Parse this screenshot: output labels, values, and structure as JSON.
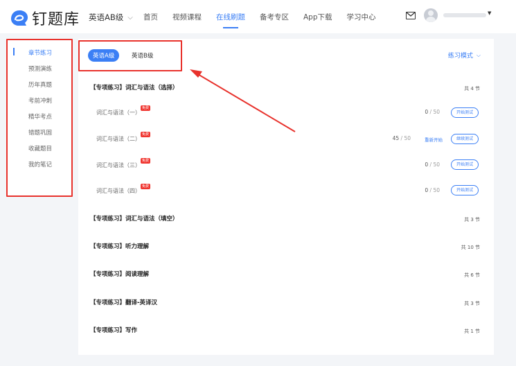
{
  "header": {
    "app_title": "钉题库",
    "level_select": "英语AB级",
    "nav": [
      "首页",
      "视频课程",
      "在线刷题",
      "备考专区",
      "App下载",
      "学习中心"
    ],
    "nav_active_index": 2,
    "icons": [
      "logo-icon",
      "chevron-down-icon",
      "mail-icon",
      "avatar-icon",
      "chevron-down-icon"
    ]
  },
  "sidebar": {
    "items": [
      "章节练习",
      "预测演练",
      "历年真题",
      "考前冲刺",
      "精华考点",
      "错题巩固",
      "收藏题目",
      "我的笔记"
    ],
    "active_index": 0
  },
  "main": {
    "tabs": [
      "英语A级",
      "英语B级"
    ],
    "active_tab": 0,
    "mode_label": "练习模式",
    "sections": [
      {
        "title": "【专项练习】词汇与语法（选择）",
        "count": "共 4 节",
        "rows": [
          {
            "label": "词汇与语法（一）",
            "badge": "免费",
            "done": "0",
            "total": " / 50",
            "reset": "",
            "button": "开始测试"
          },
          {
            "label": "词汇与语法（二）",
            "badge": "免费",
            "done": "45",
            "total": " / 50",
            "reset": "重新开始",
            "button": "继续测试"
          },
          {
            "label": "词汇与语法（三）",
            "badge": "免费",
            "done": "0",
            "total": " / 50",
            "reset": "",
            "button": "开始测试"
          },
          {
            "label": "词汇与语法（四）",
            "badge": "免费",
            "done": "0",
            "total": " / 50",
            "reset": "",
            "button": "开始测试"
          }
        ]
      },
      {
        "title": "【专项练习】词汇与语法（填空）",
        "count": "共 3 节"
      },
      {
        "title": "【专项练习】听力理解",
        "count": "共 10 节"
      },
      {
        "title": "【专项练习】阅读理解",
        "count": "共 6 节"
      },
      {
        "title": "【专项练习】翻译-英译汉",
        "count": "共 3 节"
      },
      {
        "title": "【专项练习】写作",
        "count": "共 1 节"
      }
    ]
  },
  "colors": {
    "accent": "#3b7ff5",
    "badge": "#f0352f",
    "annotation": "#e8322c"
  }
}
